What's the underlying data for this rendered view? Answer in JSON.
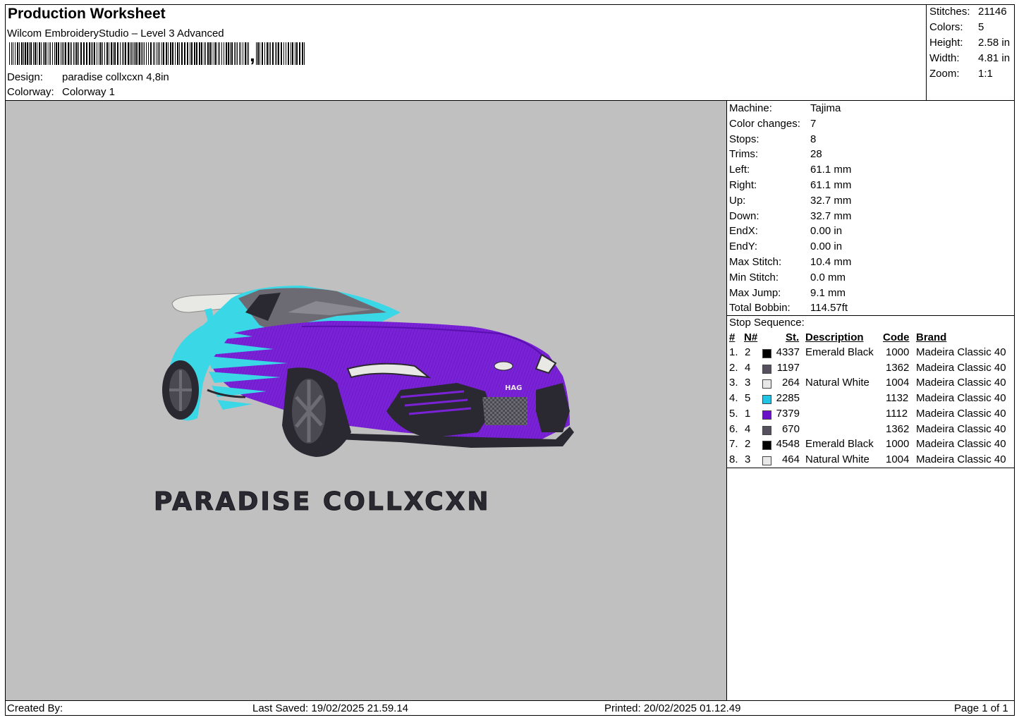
{
  "header": {
    "title": "Production Worksheet",
    "software": "Wilcom EmbroideryStudio – Level 3 Advanced",
    "barcode_suffix": ",",
    "design_label": "Design:",
    "design_value": "paradise collxcxn 4,8in",
    "colorway_label": "Colorway:",
    "colorway_value": "Colorway 1"
  },
  "stats": [
    {
      "label": "Stitches:",
      "value": "21146"
    },
    {
      "label": "Colors:",
      "value": "5"
    },
    {
      "label": "Height:",
      "value": "2.58 in"
    },
    {
      "label": "Width:",
      "value": "4.81 in"
    },
    {
      "label": "Zoom:",
      "value": "1:1"
    }
  ],
  "machine_info": [
    {
      "label": "Machine:",
      "value": "Tajima"
    },
    {
      "label": "Color changes:",
      "value": "7"
    },
    {
      "label": "Stops:",
      "value": "8"
    },
    {
      "label": "Trims:",
      "value": "28"
    },
    {
      "label": "Left:",
      "value": "61.1 mm"
    },
    {
      "label": "Right:",
      "value": "61.1 mm"
    },
    {
      "label": "Up:",
      "value": "32.7 mm"
    },
    {
      "label": "Down:",
      "value": "32.7 mm"
    },
    {
      "label": "EndX:",
      "value": "0.00 in"
    },
    {
      "label": "EndY:",
      "value": "0.00 in"
    },
    {
      "label": "Max Stitch:",
      "value": "10.4 mm"
    },
    {
      "label": "Min Stitch:",
      "value": "0.0 mm"
    },
    {
      "label": "Max Jump:",
      "value": "9.1 mm"
    },
    {
      "label": "Total Bobbin:",
      "value": "114.57ft"
    }
  ],
  "stop_sequence": {
    "title": "Stop Sequence:",
    "headers": {
      "num": "#",
      "n": "N#",
      "st": "St.",
      "desc": "Description",
      "code": "Code",
      "brand": "Brand"
    },
    "rows": [
      {
        "num": "1.",
        "n": "2",
        "color": "#000000",
        "st": "4337",
        "desc": "Emerald Black",
        "code": "1000",
        "brand": "Madeira Classic 40"
      },
      {
        "num": "2.",
        "n": "4",
        "color": "#54505e",
        "st": "1197",
        "desc": "",
        "code": "1362",
        "brand": "Madeira Classic 40"
      },
      {
        "num": "3.",
        "n": "3",
        "color": "#e8e8e8",
        "st": "264",
        "desc": "Natural White",
        "code": "1004",
        "brand": "Madeira Classic 40"
      },
      {
        "num": "4.",
        "n": "5",
        "color": "#22c4e4",
        "st": "2285",
        "desc": "",
        "code": "1132",
        "brand": "Madeira Classic 40"
      },
      {
        "num": "5.",
        "n": "1",
        "color": "#6a12c8",
        "st": "7379",
        "desc": "",
        "code": "1112",
        "brand": "Madeira Classic 40"
      },
      {
        "num": "6.",
        "n": "4",
        "color": "#54505e",
        "st": "670",
        "desc": "",
        "code": "1362",
        "brand": "Madeira Classic 40"
      },
      {
        "num": "7.",
        "n": "2",
        "color": "#000000",
        "st": "4548",
        "desc": "Emerald Black",
        "code": "1000",
        "brand": "Madeira Classic 40"
      },
      {
        "num": "8.",
        "n": "3",
        "color": "#e8e8e8",
        "st": "464",
        "desc": "Natural White",
        "code": "1004",
        "brand": "Madeira Classic 40"
      }
    ]
  },
  "design": {
    "embroidered_text": "PARADISE COLLXCXN",
    "badge_text": "HAG",
    "colors": {
      "background": "#c0c0c0",
      "purple": "#7a22d6",
      "cyan": "#3ad8e6",
      "dark": "#2a2830",
      "grey": "#6c6a72",
      "white": "#e8e8e4"
    }
  },
  "footer": {
    "created_by": "Created By:",
    "last_saved": "Last Saved: 19/02/2025 21.59.14",
    "printed": "Printed: 20/02/2025 01.12.49",
    "page": "Page 1 of 1"
  }
}
